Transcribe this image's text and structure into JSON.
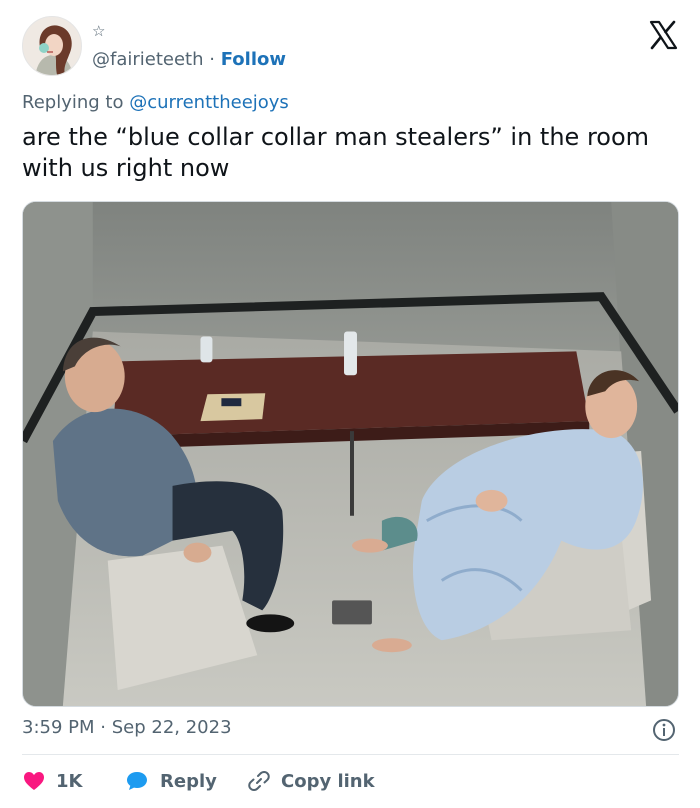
{
  "author": {
    "handle": "@fairieteeth",
    "separator": "·",
    "follow_label": "Follow"
  },
  "reply_context": {
    "prefix": "Replying to",
    "mention": "@currenttheejoys"
  },
  "tweet": {
    "text": "are the “blue collar collar man stealers” in the room with us right now"
  },
  "meta": {
    "time": "3:59 PM",
    "separator": "·",
    "date": "Sep 22, 2023"
  },
  "actions": {
    "like_count": "1K",
    "reply_label": "Reply",
    "copy_label": "Copy link"
  },
  "icons": [
    "star-icon",
    "x-logo-icon",
    "info-icon",
    "heart-icon",
    "reply-bubble-icon",
    "link-icon"
  ],
  "colors": {
    "link": "#1d72b8",
    "muted": "#536471",
    "like": "#f91880",
    "reply": "#1d9bf0"
  }
}
